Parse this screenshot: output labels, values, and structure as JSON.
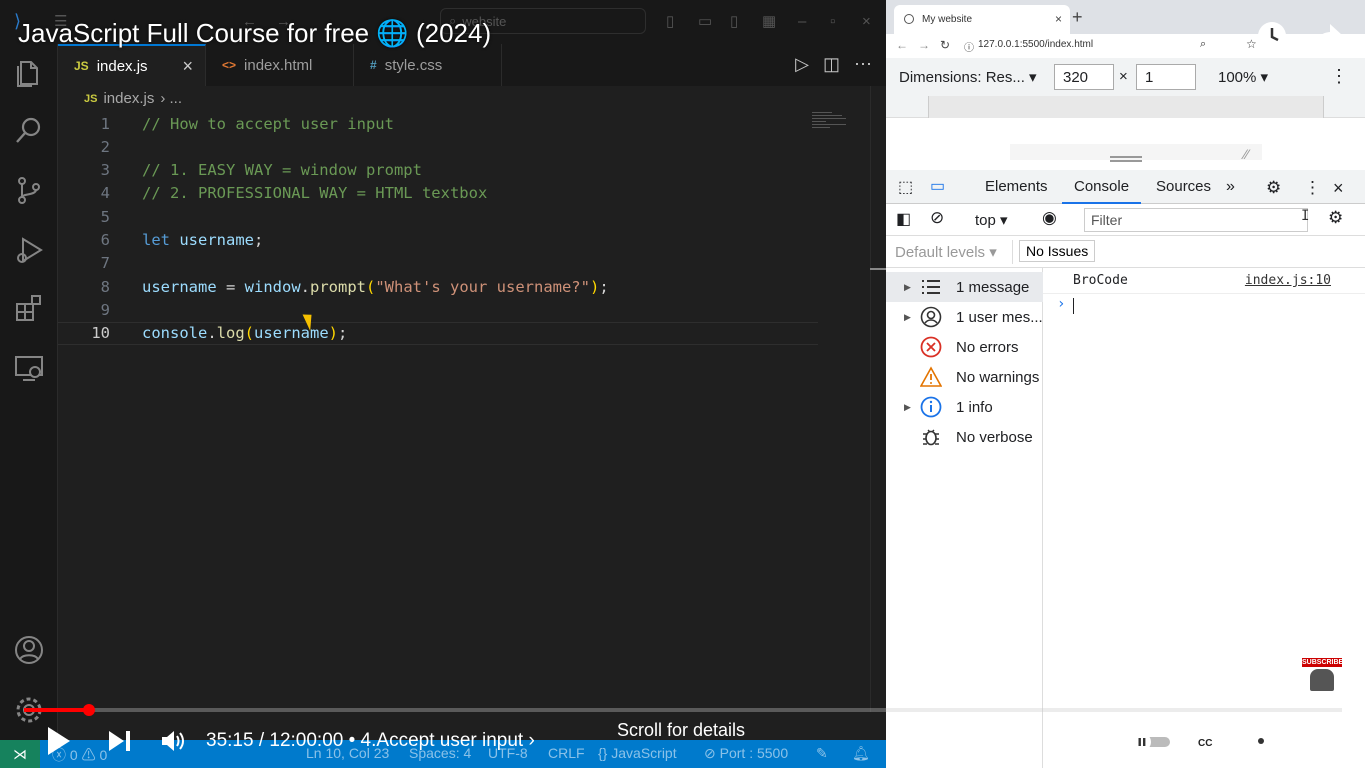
{
  "video": {
    "title": "JavaScript Full Course for free 🌐 (2024)",
    "time": "35:15 / 12:00:00",
    "chapter": "• 4.Accept user input ›",
    "scroll_hint": "Scroll for details",
    "progress": 0.049,
    "buffered_segments": true,
    "accent": "#ff0000"
  },
  "vscode": {
    "search_placeholder": "website",
    "tabs": [
      {
        "icon": "JS",
        "label": "index.js",
        "active": true
      },
      {
        "icon": "<>",
        "label": "index.html",
        "active": false
      },
      {
        "icon": "#",
        "label": "style.css",
        "active": false
      }
    ],
    "breadcrumb": {
      "icon": "JS",
      "file": "index.js",
      "rest": "› ..."
    },
    "code_lines": [
      {
        "n": "1",
        "tokens": [
          {
            "t": "// How to accept user input",
            "c": "c-comment"
          }
        ]
      },
      {
        "n": "2",
        "tokens": []
      },
      {
        "n": "3",
        "tokens": [
          {
            "t": "// 1. EASY WAY = window prompt",
            "c": "c-comment"
          }
        ]
      },
      {
        "n": "4",
        "tokens": [
          {
            "t": "// 2. PROFESSIONAL WAY = HTML textbox",
            "c": "c-comment"
          }
        ]
      },
      {
        "n": "5",
        "tokens": []
      },
      {
        "n": "6",
        "tokens": [
          {
            "t": "let ",
            "c": "c-kw"
          },
          {
            "t": "username",
            "c": "c-var"
          },
          {
            "t": ";",
            "c": "c-punc"
          }
        ]
      },
      {
        "n": "7",
        "tokens": []
      },
      {
        "n": "8",
        "tokens": [
          {
            "t": "username",
            "c": "c-var"
          },
          {
            "t": " = ",
            "c": "c-punc"
          },
          {
            "t": "window",
            "c": "c-var"
          },
          {
            "t": ".",
            "c": "c-punc"
          },
          {
            "t": "prompt",
            "c": "c-fn"
          },
          {
            "t": "(",
            "c": "c-paren"
          },
          {
            "t": "\"What's your username?\"",
            "c": "c-str"
          },
          {
            "t": ")",
            "c": "c-paren"
          },
          {
            "t": ";",
            "c": "c-punc"
          }
        ]
      },
      {
        "n": "9",
        "tokens": []
      },
      {
        "n": "10",
        "tokens": [
          {
            "t": "console",
            "c": "c-var"
          },
          {
            "t": ".",
            "c": "c-punc"
          },
          {
            "t": "log",
            "c": "c-fn"
          },
          {
            "t": "(",
            "c": "c-paren"
          },
          {
            "t": "username",
            "c": "c-var"
          },
          {
            "t": ")",
            "c": "c-paren"
          },
          {
            "t": ";",
            "c": "c-punc"
          }
        ]
      }
    ],
    "current_line": "10",
    "status": {
      "errors": "0",
      "warnings": "0",
      "position": "Ln 10, Col 23",
      "spaces": "Spaces: 4",
      "encoding": "UTF-8",
      "eol": "CRLF",
      "language": "JavaScript",
      "port": "Port : 5500"
    },
    "status_color": "#007acc"
  },
  "browser": {
    "tab_title": "My website",
    "url": "127.0.0.1:5500/index.html",
    "device": {
      "dimensions_label": "Dimensions: Res...",
      "width": "320",
      "times": "×",
      "height": "1",
      "zoom": "100%"
    },
    "devtools": {
      "tabs": [
        "Elements",
        "Console",
        "Sources"
      ],
      "active_tab": "Console",
      "context": "top",
      "filter_placeholder": "Filter",
      "levels": "Default levels",
      "issues": "No Issues",
      "sidebar": [
        {
          "label": "1 message",
          "icon": "list-icon",
          "expandable": true,
          "selected": true
        },
        {
          "label": "1 user mes...",
          "icon": "user-icon",
          "expandable": true,
          "selected": false
        },
        {
          "label": "No errors",
          "icon": "error-icon",
          "expandable": false,
          "selected": false
        },
        {
          "label": "No warnings",
          "icon": "warning-icon",
          "expandable": false,
          "selected": false
        },
        {
          "label": "1 info",
          "icon": "info-icon",
          "expandable": true,
          "selected": false
        },
        {
          "label": "No verbose",
          "icon": "bug-icon",
          "expandable": false,
          "selected": false
        }
      ],
      "log": {
        "message": "BroCode",
        "source": "index.js:10"
      },
      "prompt_symbol": "›"
    }
  },
  "subscribe_badge": "SUBSCRIBE"
}
